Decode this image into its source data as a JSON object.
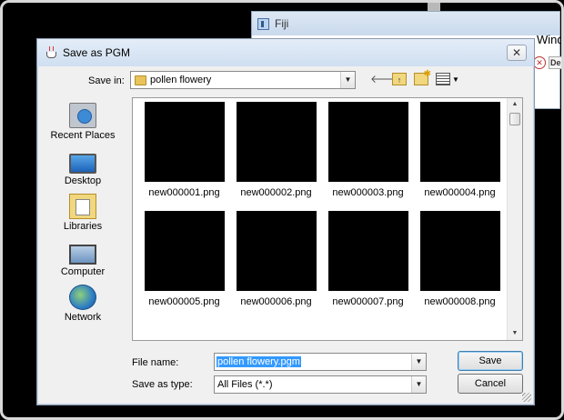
{
  "fiji_window": {
    "title": "Fiji",
    "menu_text": "Wind",
    "tool_label": "De"
  },
  "dialog": {
    "title": "Save as PGM",
    "close_label": "✕",
    "save_in_label": "Save in:",
    "current_folder": "pollen flowery",
    "places": [
      {
        "label": "Recent Places",
        "icon": "recent-places-icon"
      },
      {
        "label": "Desktop",
        "icon": "desktop-icon"
      },
      {
        "label": "Libraries",
        "icon": "libraries-icon"
      },
      {
        "label": "Computer",
        "icon": "computer-icon"
      },
      {
        "label": "Network",
        "icon": "network-icon"
      }
    ],
    "files": [
      "new000001.png",
      "new000002.png",
      "new000003.png",
      "new000004.png",
      "new000005.png",
      "new000006.png",
      "new000007.png",
      "new000008.png"
    ],
    "file_name_label": "File name:",
    "file_name_value": "pollen flowery.pgm",
    "save_as_type_label": "Save as type:",
    "save_as_type_value": "All Files (*.*)",
    "save_button": "Save",
    "cancel_button": "Cancel"
  }
}
